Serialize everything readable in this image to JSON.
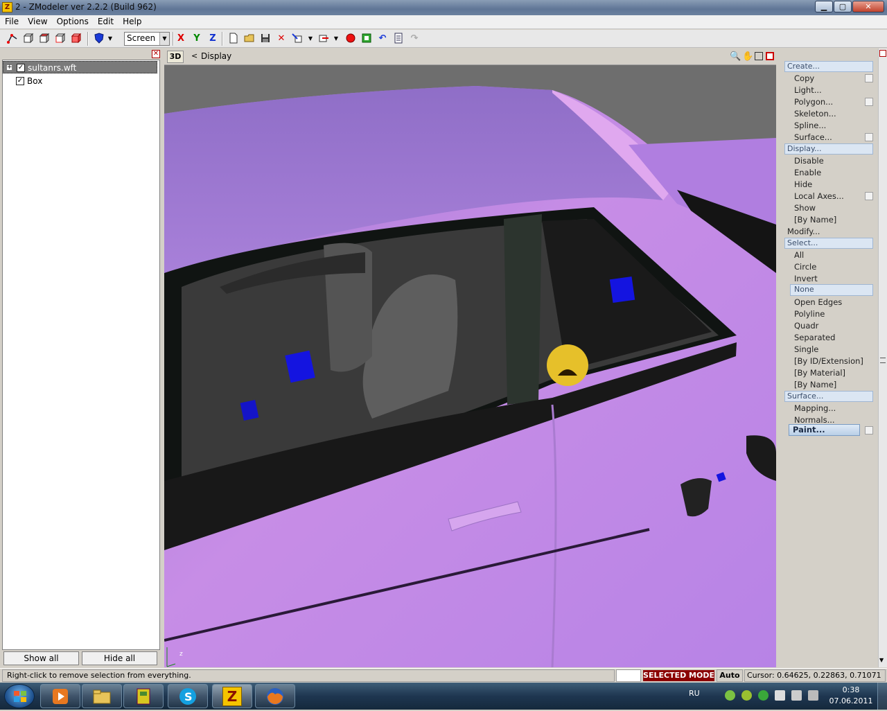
{
  "window": {
    "title": "2 - ZModeler ver 2.2.2 (Build 962)",
    "app_icon": "Z",
    "min_glyph": "▁",
    "max_glyph": "▢",
    "close_glyph": "✕"
  },
  "menu": [
    "File",
    "View",
    "Options",
    "Edit",
    "Help"
  ],
  "toolbar": {
    "view_mode": "Screen",
    "x_axis": "X",
    "y_axis": "Y",
    "z_axis": "Z"
  },
  "left_panel": {
    "close_glyph": "✕",
    "tree": [
      {
        "label": "sultanrs.wft",
        "checked": true,
        "selected": true,
        "expander": "+"
      },
      {
        "label": "Box",
        "checked": true,
        "selected": false
      }
    ],
    "check_glyph": "✓",
    "show_all": "Show all",
    "hide_all": "Hide all"
  },
  "viewport": {
    "mode": "3D",
    "breadcrumb_arrow": "<",
    "breadcrumb": "Display",
    "axis_gizmo": "z"
  },
  "command_panel": {
    "create": {
      "header": "Create...",
      "items": [
        "Copy",
        "Light...",
        "Polygon...",
        "Skeleton...",
        "Spline...",
        "Surface..."
      ]
    },
    "display": {
      "header": "Display...",
      "items": [
        "Disable",
        "Enable",
        "Hide",
        "Local Axes...",
        "Show",
        "[By Name]"
      ]
    },
    "modify": "Modify...",
    "select": {
      "header": "Select...",
      "items": [
        "All",
        "Circle",
        "Invert",
        "None",
        "Open Edges",
        "Polyline",
        "Quadr",
        "Separated",
        "Single",
        "[By ID/Extension]",
        "[By Material]",
        "[By Name]"
      ]
    },
    "surface": {
      "header": "Surface...",
      "items": [
        "Mapping...",
        "Normals...",
        "Paint..."
      ]
    }
  },
  "status": {
    "hint": "Right-click to remove selection from everything.",
    "mode": "SELECTED MODE",
    "snap": "Auto",
    "cursor": "Cursor: 0.64625, 0.22863, 0.71071"
  },
  "taskbar": {
    "language": "RU",
    "time": "0:38",
    "date": "07.06.2011",
    "zmodeler_label": "Z"
  },
  "colors": {
    "car_paint": "#c88ae8",
    "interior": "#3a3a3a",
    "helper_box": "#1414e0",
    "accent_status": "#8b0000"
  }
}
